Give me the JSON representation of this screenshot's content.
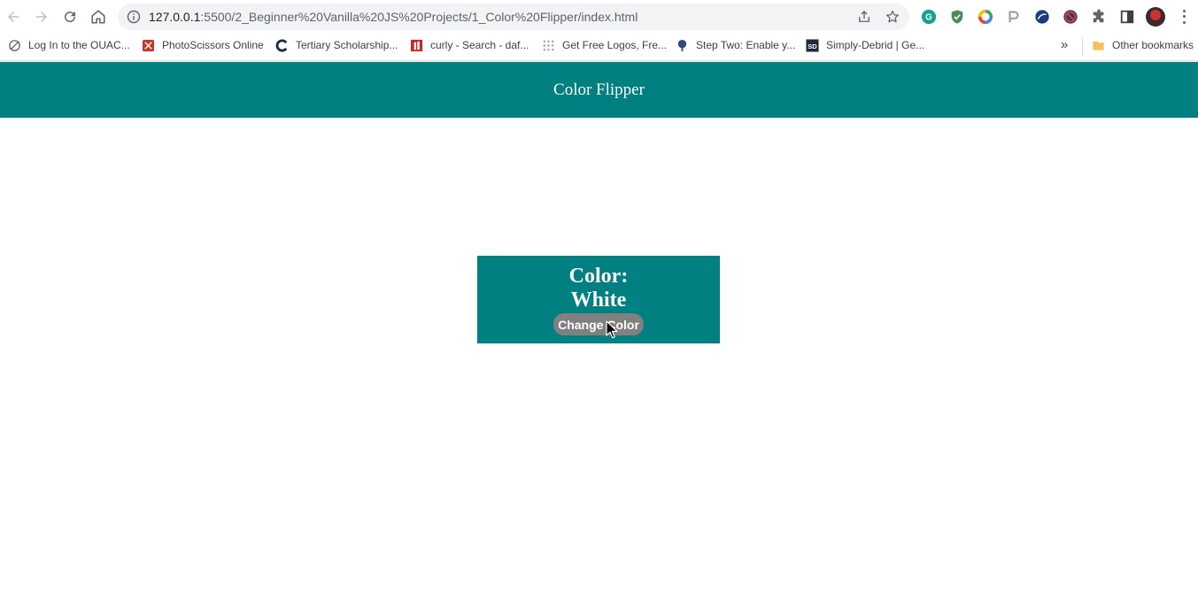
{
  "browser": {
    "url": {
      "host": "127.0.0.1",
      "rest": ":5500/2_Beginner%20Vanilla%20JS%20Projects/1_Color%20Flipper/index.html"
    },
    "icons": {
      "back": "back-arrow-icon",
      "forward": "forward-arrow-icon",
      "reload": "reload-icon",
      "home": "home-icon",
      "site_info": "info-icon",
      "share": "share-icon",
      "bookmark_star": "star-icon",
      "extensions": [
        "grammarly-icon",
        "shield-extension-icon",
        "color-ring-extension-icon",
        "pin-extension-icon",
        "blue-circle-extension-icon",
        "red-blocked-extension-icon",
        "puzzle-icon",
        "side-panel-icon"
      ],
      "profile": "avatar",
      "menu": "kebab-menu-icon"
    }
  },
  "bookmarks": {
    "items": [
      {
        "label": "Log In to the OUAC...",
        "icon": "globe-slash-icon"
      },
      {
        "label": "PhotoScissors Online",
        "icon": "photoscissors-icon"
      },
      {
        "label": "Tertiary Scholarship...",
        "icon": "c-logo-icon"
      },
      {
        "label": "curly - Search - daf...",
        "icon": "dafont-icon"
      },
      {
        "label": "Get Free Logos, Fre...",
        "icon": "dots-grid-icon"
      },
      {
        "label": "Step Two: Enable y...",
        "icon": "tree-icon"
      },
      {
        "label": "Simply-Debrid | Ge...",
        "icon": "sd-logo-icon"
      }
    ],
    "overflow_icon": "chevron-double-right-icon",
    "other_label": "Other bookmarks",
    "other_icon": "folder-icon"
  },
  "page": {
    "header_title": "Color Flipper",
    "color_prefix": "Color:",
    "color_value": "White",
    "button_label": "Change Color"
  },
  "colors": {
    "header_bg": "#008080",
    "card_bg": "#008080",
    "button_bg": "#808080",
    "text": "#ffffff"
  }
}
